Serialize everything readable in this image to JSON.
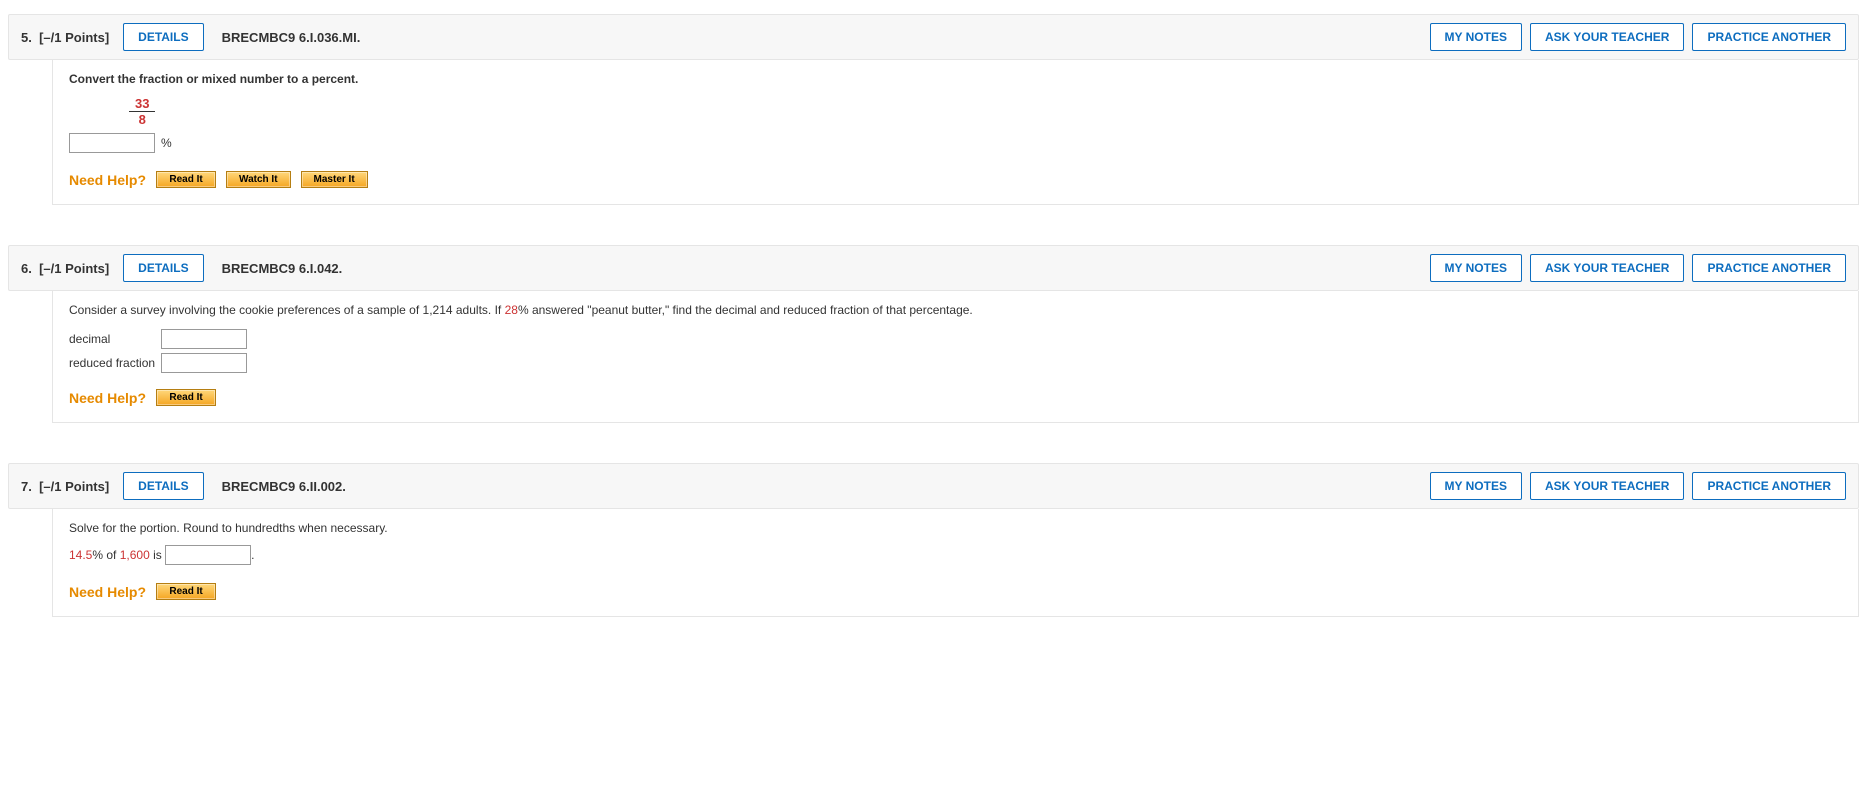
{
  "buttons": {
    "details": "DETAILS",
    "my_notes": "MY NOTES",
    "ask_teacher": "ASK YOUR TEACHER",
    "practice_another": "PRACTICE ANOTHER"
  },
  "need_help": {
    "label": "Need Help?",
    "read_it": "Read It",
    "watch_it": "Watch It",
    "master_it": "Master It"
  },
  "q5": {
    "number_prefix": "5.",
    "points": "[–/1 Points]",
    "code": "BRECMBC9 6.I.036.MI.",
    "prompt": "Convert the fraction or mixed number to a percent.",
    "fraction_num": "33",
    "fraction_den": "8",
    "unit": "%"
  },
  "q6": {
    "number_prefix": "6.",
    "points": "[–/1 Points]",
    "code": "BRECMBC9 6.I.042.",
    "prompt_pre": "Consider a survey involving the cookie preferences of a sample of 1,214 adults. If ",
    "prompt_percent": "28",
    "prompt_post": "% answered \"peanut butter,\" find the decimal and reduced fraction of that percentage.",
    "row1_label": "decimal",
    "row2_label": "reduced fraction"
  },
  "q7": {
    "number_prefix": "7.",
    "points": "[–/1 Points]",
    "code": "BRECMBC9 6.II.002.",
    "prompt": "Solve for the portion. Round to hundredths when necessary.",
    "solve_val1": "14.5",
    "solve_mid1": "% of ",
    "solve_val2": "1,600",
    "solve_mid2": " is ",
    "solve_tail": "."
  }
}
